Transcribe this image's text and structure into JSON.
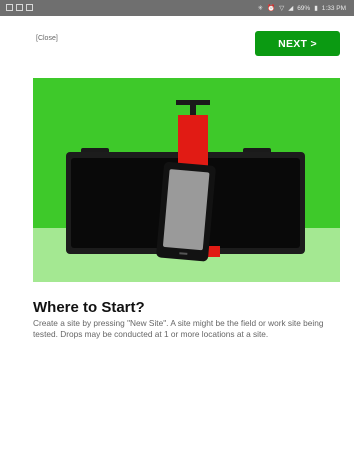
{
  "status_bar": {
    "icons_left": [
      "gallery-icon",
      "sim-icon",
      "photo-icon"
    ],
    "icons_right": [
      "bluetooth-icon",
      "alarm-icon",
      "wifi-icon",
      "signal-icon"
    ],
    "battery": "69%",
    "time": "1:33 PM"
  },
  "top": {
    "close_label": "[Close]",
    "next_label": "NEXT >"
  },
  "hero": {
    "background_color": "#3ec92a",
    "floor_color": "#a4e892",
    "plunger_color": "#e11b14",
    "screen_color": "#0a0a0a",
    "tablet_screen_color": "#9a9a9a"
  },
  "content": {
    "title": "Where to Start?",
    "description": "Create a site by pressing \"New Site\".  A site might be the field or work site being tested. Drops may be conducted at 1 or more locations at a site."
  },
  "colors": {
    "accent": "#0b9a12",
    "status_bar": "#6f6f6f"
  }
}
